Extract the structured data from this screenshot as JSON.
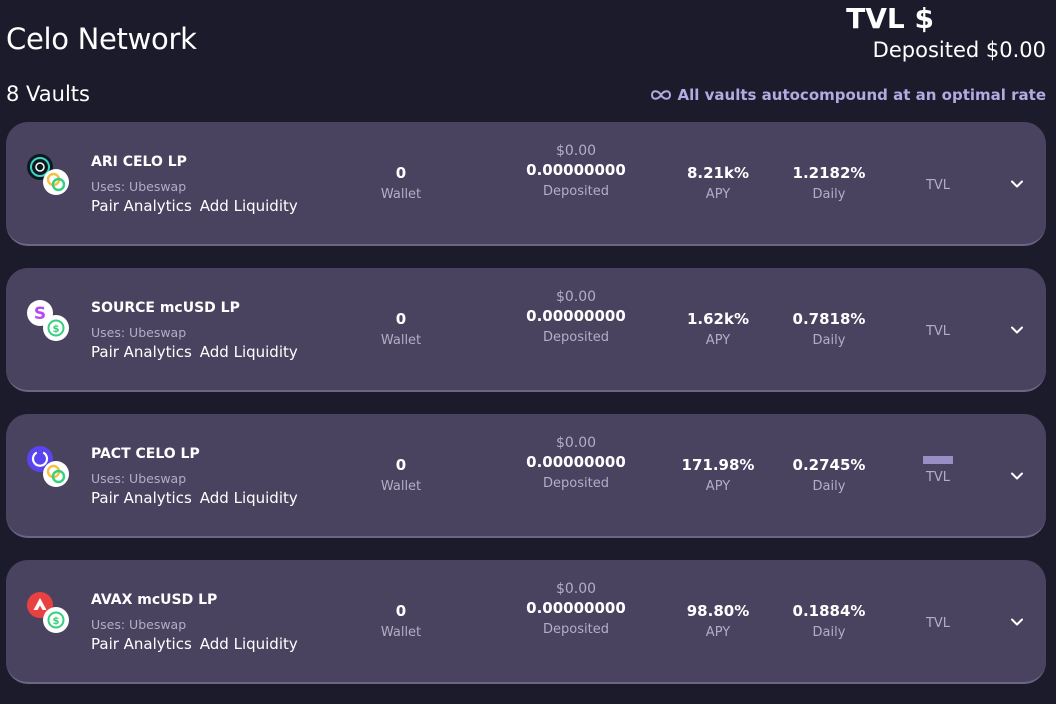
{
  "header": {
    "title": "Celo Network",
    "tvl": "TVL $",
    "deposited": "Deposited $0.00",
    "vault_count": "8 Vaults",
    "autocompound": "All vaults autocompound at an optimal rate"
  },
  "labels": {
    "wallet": "Wallet",
    "deposited": "Deposited",
    "apy": "APY",
    "daily": "Daily",
    "tvl": "TVL",
    "pair_analytics": "Pair Analytics",
    "add_liquidity": "Add Liquidity"
  },
  "colors": {
    "background": "#1c1b2b",
    "card": "#4a4360",
    "accent": "#b4a9e0",
    "muted": "#b3adc6"
  },
  "vaults": [
    {
      "name": "ARI CELO LP",
      "uses": "Uses: Ubeswap",
      "wallet": "0",
      "deposited_usd": "$0.00",
      "deposited": "0.00000000",
      "apy": "8.21k%",
      "daily": "1.2182%",
      "icon_a": "ari-icon",
      "icon_b": "celo-icon"
    },
    {
      "name": "SOURCE mcUSD LP",
      "uses": "Uses: Ubeswap",
      "wallet": "0",
      "deposited_usd": "$0.00",
      "deposited": "0.00000000",
      "apy": "1.62k%",
      "daily": "0.7818%",
      "icon_a": "source-icon",
      "icon_b": "mcusd-icon"
    },
    {
      "name": "PACT CELO LP",
      "uses": "Uses: Ubeswap",
      "wallet": "0",
      "deposited_usd": "$0.00",
      "deposited": "0.00000000",
      "apy": "171.98%",
      "daily": "0.2745%",
      "icon_a": "pact-icon",
      "icon_b": "celo-icon"
    },
    {
      "name": "AVAX mcUSD LP",
      "uses": "Uses: Ubeswap",
      "wallet": "0",
      "deposited_usd": "$0.00",
      "deposited": "0.00000000",
      "apy": "98.80%",
      "daily": "0.1884%",
      "icon_a": "avax-icon",
      "icon_b": "mcusd-icon"
    }
  ]
}
